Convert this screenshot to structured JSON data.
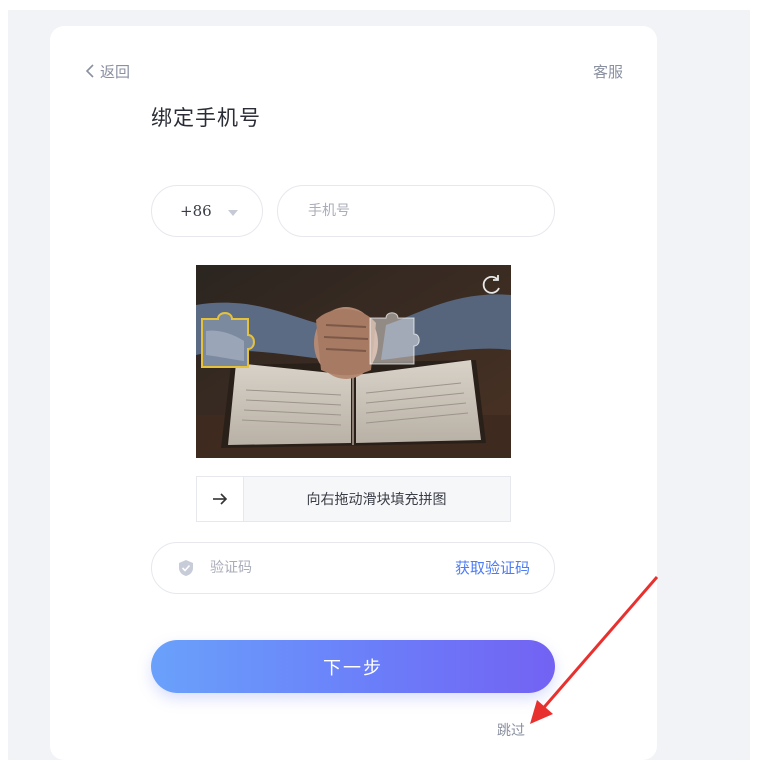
{
  "header": {
    "back_label": "返回",
    "service_label": "客服",
    "title": "绑定手机号"
  },
  "form": {
    "country_code": "+86",
    "phone_placeholder": "手机号",
    "captcha_hint": "向右拖动滑块填充拼图",
    "code_placeholder": "验证码",
    "get_code_label": "获取验证码",
    "next_label": "下一步",
    "skip_label": "跳过"
  },
  "colors": {
    "accent": "#4e7cf4",
    "button_gradient_start": "#6aa1fb",
    "button_gradient_end": "#7362f3",
    "annotation_arrow": "#e8312f"
  },
  "icons": {
    "back": "chevron-left-icon",
    "dropdown": "triangle-down-icon",
    "refresh": "refresh-icon",
    "slider": "arrow-right-icon",
    "shield": "shield-icon"
  }
}
